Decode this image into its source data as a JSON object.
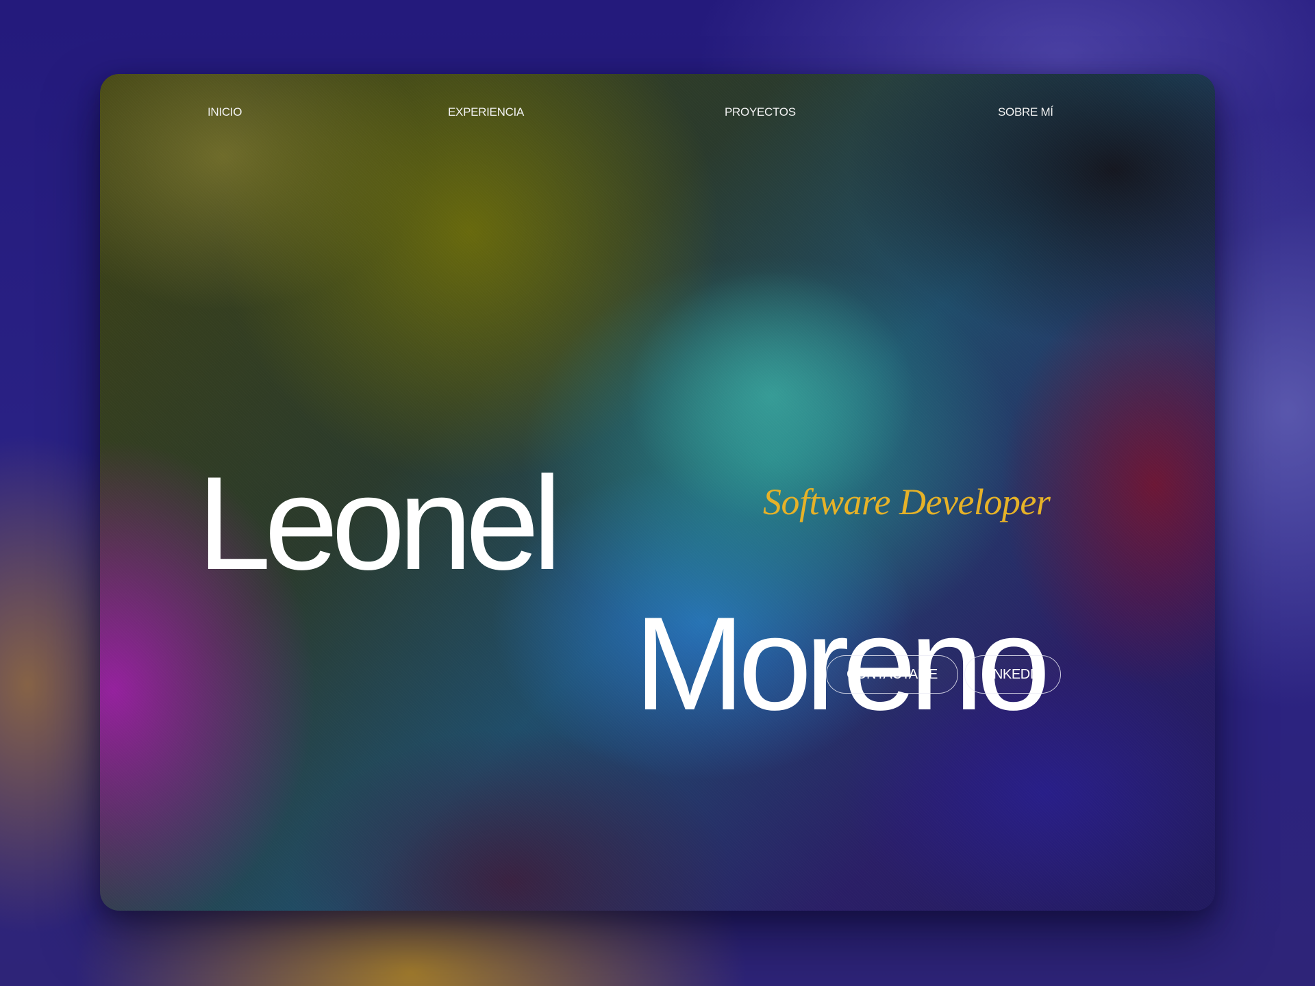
{
  "nav": {
    "items": [
      {
        "label": "INICIO"
      },
      {
        "label": "EXPERIENCIA"
      },
      {
        "label": "PROYECTOS"
      },
      {
        "label": "SOBRE MÍ"
      }
    ]
  },
  "hero": {
    "first_name": "Leonel",
    "last_name": "Moreno",
    "role": "Software Developer"
  },
  "actions": {
    "contact_label": "CONTACTAME",
    "linkedin_label": "LINKEDIN"
  },
  "colors": {
    "page_background": "#25197a",
    "name_text": "#ffffff",
    "role_accent": "#e6b228",
    "button_border": "#ebebf5"
  }
}
